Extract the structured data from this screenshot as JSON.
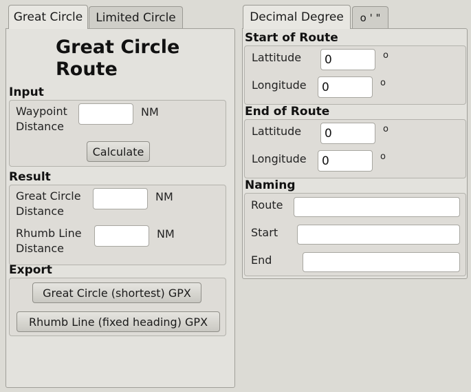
{
  "left_tabs": [
    "Great Circle",
    "Limited Circle"
  ],
  "right_tabs": [
    "Decimal Degree",
    "o ' \""
  ],
  "title_line1": "Great Circle",
  "title_line2": "Route",
  "input": {
    "section": "Input",
    "waypoint_label_1": "Waypoint",
    "waypoint_label_2": "Distance",
    "waypoint_value": "",
    "unit": "NM",
    "calculate": "Calculate"
  },
  "result": {
    "section": "Result",
    "gc_label_1": "Great Circle",
    "gc_label_2": "Distance",
    "gc_value": "",
    "rl_label_1": "Rhumb Line",
    "rl_label_2": "Distance",
    "rl_value": "",
    "unit": "NM"
  },
  "export": {
    "section": "Export",
    "gc_button": "Great Circle (shortest) GPX",
    "rl_button": "Rhumb Line (fixed heading) GPX"
  },
  "start": {
    "section": "Start of Route",
    "lat_label": "Lattitude",
    "lat_value": "0",
    "lon_label": "Longitude",
    "lon_value": "0",
    "deg": "o"
  },
  "end": {
    "section": "End of Route",
    "lat_label": "Lattitude",
    "lat_value": "0",
    "lon_label": "Longitude",
    "lon_value": "0",
    "deg": "o"
  },
  "naming": {
    "section": "Naming",
    "route_label": "Route",
    "route_value": "",
    "start_label": "Start",
    "start_value": "",
    "end_label": "End",
    "end_value": ""
  }
}
